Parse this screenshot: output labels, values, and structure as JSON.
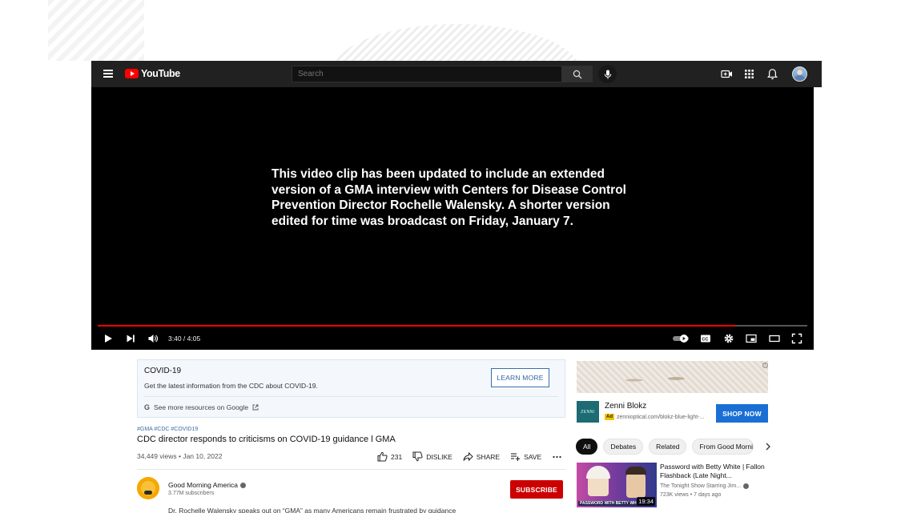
{
  "header": {
    "logo_text": "YouTube",
    "search_placeholder": "Search"
  },
  "player": {
    "overlay_lines": [
      "This video clip has been updated to include an extended",
      "version of a GMA interview with Centers for Disease Control",
      "Prevention Director Rochelle Walensky. A shorter version",
      "edited for time was broadcast on Friday, January 7."
    ],
    "time": "3:40 / 4:05",
    "progress_fraction": 0.898
  },
  "info_panel": {
    "title": "COVID-19",
    "description": "Get the latest information from the CDC about COVID-19.",
    "learn_more": "LEARN MORE",
    "resources_link": "See more resources on Google"
  },
  "video": {
    "hashtags": "#GMA #CDC #COVID19",
    "title": "CDC director responds to criticisms on COVID-19 guidance l GMA",
    "meta": "34,449 views • Jan 10, 2022",
    "likes": "231",
    "dislike": "DISLIKE",
    "share": "SHARE",
    "save": "SAVE"
  },
  "channel": {
    "name": "Good Morning America",
    "subscribers": "3.77M subscribers",
    "subscribe": "SUBSCRIBE",
    "description": "Dr. Rochelle Walensky speaks out on “GMA” as many Americans remain frustrated by guidance"
  },
  "ad": {
    "logo_text": "ZENNI",
    "name": "Zenni Blokz",
    "badge": "Ad",
    "url": "zennioptical.com/blokz-blue-light-...",
    "cta": "SHOP NOW"
  },
  "chips": [
    "All",
    "Debates",
    "Related",
    "From Good Morni"
  ],
  "recommendation": {
    "title": "Password with Betty White | Fallon Flashback (Late Night...",
    "channel": "The Tonight Show Starring Jim...",
    "meta": "723K views • 7 days ago",
    "duration": "19:34",
    "thumb_caption": "PASSWORD WITH BETTY WH"
  }
}
